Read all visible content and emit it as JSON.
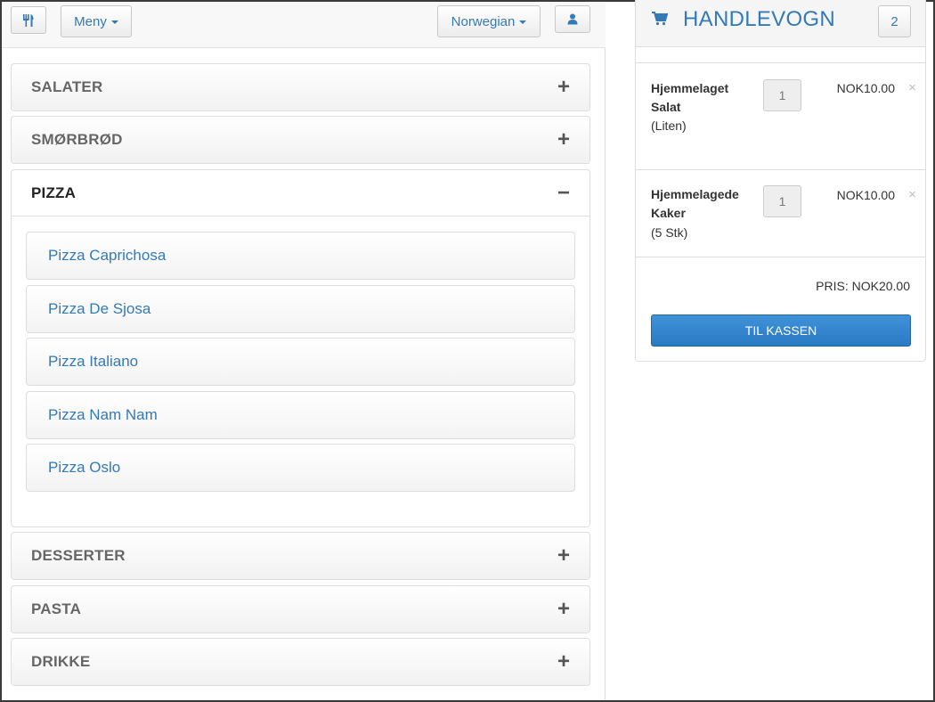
{
  "topbar": {
    "home_icon": "utensils-icon",
    "menu_label": "Meny",
    "language_label": "Norwegian",
    "user_icon": "user-icon"
  },
  "categories": [
    {
      "label": "SALATER",
      "open": false,
      "toggle": "+"
    },
    {
      "label": "SMØRBRØD",
      "open": false,
      "toggle": "+"
    },
    {
      "label": "PIZZA",
      "open": true,
      "toggle": "−",
      "items": [
        "Pizza Caprichosa",
        "Pizza De Sjosa",
        "Pizza Italiano",
        "Pizza Nam Nam",
        "Pizza Oslo"
      ]
    },
    {
      "label": "DESSERTER",
      "open": false,
      "toggle": "+"
    },
    {
      "label": "PASTA",
      "open": false,
      "toggle": "+"
    },
    {
      "label": "DRIKKE",
      "open": false,
      "toggle": "+"
    }
  ],
  "cart": {
    "icon": "shopping-cart-icon",
    "title": "HANDLEVOGN",
    "count": "2",
    "items": [
      {
        "name": "Hjemmelaget Salat",
        "variant": "(Liten)",
        "qty": "1",
        "price": "NOK10.00",
        "remove": "×"
      },
      {
        "name": "Hjemmelagede Kaker",
        "variant": "(5 Stk)",
        "qty": "1",
        "price": "NOK10.00",
        "remove": "×"
      }
    ],
    "total": "PRIS: NOK20.00",
    "checkout_label": "TIL KASSEN"
  },
  "colors": {
    "accent": "#337ab7",
    "checkout": "#2a79c4"
  }
}
